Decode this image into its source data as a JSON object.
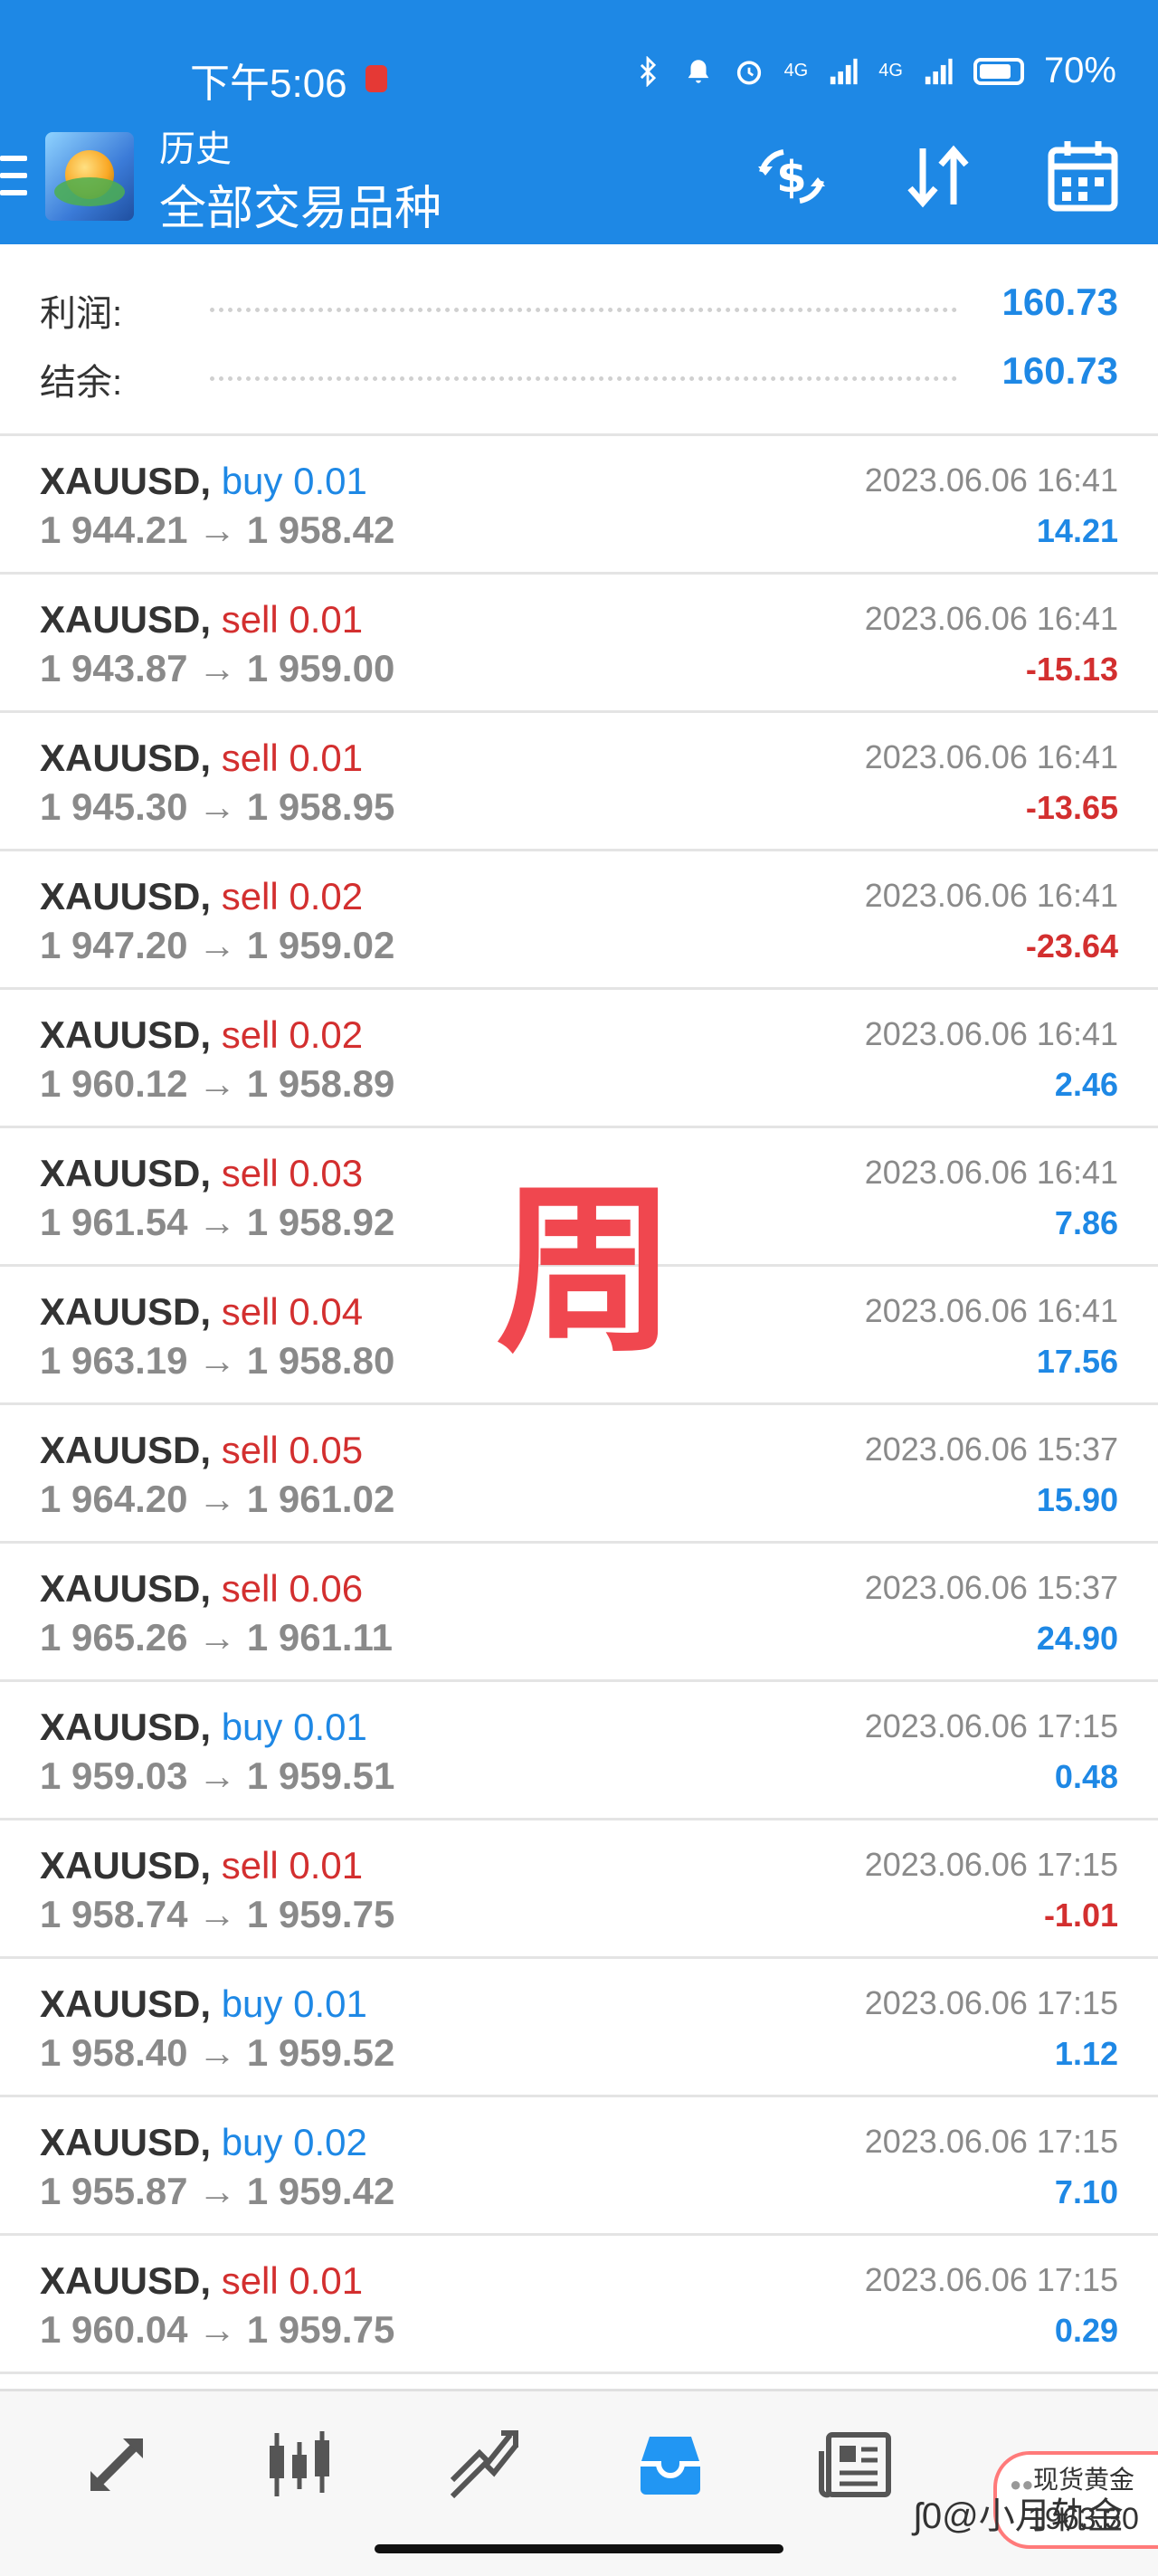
{
  "status_bar": {
    "time": "下午5:06",
    "network1": "4G",
    "network2": "4G",
    "battery": "70%"
  },
  "header": {
    "subtitle": "历史",
    "title": "全部交易品种",
    "icons": [
      "menu-icon",
      "app-logo",
      "currency-exchange-icon",
      "sort-icon",
      "calendar-icon"
    ]
  },
  "summary": {
    "profit_label": "利润:",
    "profit_value": "160.73",
    "balance_label": "结余:",
    "balance_value": "160.73"
  },
  "trades": [
    {
      "symbol": "XAUUSD,",
      "type": "buy",
      "volume": "0.01",
      "prices": "1 944.21 → 1 958.42",
      "time": "2023.06.06 16:41",
      "profit": "14.21"
    },
    {
      "symbol": "XAUUSD,",
      "type": "sell",
      "volume": "0.01",
      "prices": "1 943.87 → 1 959.00",
      "time": "2023.06.06 16:41",
      "profit": "-15.13"
    },
    {
      "symbol": "XAUUSD,",
      "type": "sell",
      "volume": "0.01",
      "prices": "1 945.30 → 1 958.95",
      "time": "2023.06.06 16:41",
      "profit": "-13.65"
    },
    {
      "symbol": "XAUUSD,",
      "type": "sell",
      "volume": "0.02",
      "prices": "1 947.20 → 1 959.02",
      "time": "2023.06.06 16:41",
      "profit": "-23.64"
    },
    {
      "symbol": "XAUUSD,",
      "type": "sell",
      "volume": "0.02",
      "prices": "1 960.12 → 1 958.89",
      "time": "2023.06.06 16:41",
      "profit": "2.46"
    },
    {
      "symbol": "XAUUSD,",
      "type": "sell",
      "volume": "0.03",
      "prices": "1 961.54 → 1 958.92",
      "time": "2023.06.06 16:41",
      "profit": "7.86"
    },
    {
      "symbol": "XAUUSD,",
      "type": "sell",
      "volume": "0.04",
      "prices": "1 963.19 → 1 958.80",
      "time": "2023.06.06 16:41",
      "profit": "17.56"
    },
    {
      "symbol": "XAUUSD,",
      "type": "sell",
      "volume": "0.05",
      "prices": "1 964.20 → 1 961.02",
      "time": "2023.06.06 15:37",
      "profit": "15.90"
    },
    {
      "symbol": "XAUUSD,",
      "type": "sell",
      "volume": "0.06",
      "prices": "1 965.26 → 1 961.11",
      "time": "2023.06.06 15:37",
      "profit": "24.90"
    },
    {
      "symbol": "XAUUSD,",
      "type": "buy",
      "volume": "0.01",
      "prices": "1 959.03 → 1 959.51",
      "time": "2023.06.06 17:15",
      "profit": "0.48"
    },
    {
      "symbol": "XAUUSD,",
      "type": "sell",
      "volume": "0.01",
      "prices": "1 958.74 → 1 959.75",
      "time": "2023.06.06 17:15",
      "profit": "-1.01"
    },
    {
      "symbol": "XAUUSD,",
      "type": "buy",
      "volume": "0.01",
      "prices": "1 958.40 → 1 959.52",
      "time": "2023.06.06 17:15",
      "profit": "1.12"
    },
    {
      "symbol": "XAUUSD,",
      "type": "buy",
      "volume": "0.02",
      "prices": "1 955.87 → 1 959.42",
      "time": "2023.06.06 17:15",
      "profit": "7.10"
    },
    {
      "symbol": "XAUUSD,",
      "type": "sell",
      "volume": "0.01",
      "prices": "1 960.04 → 1 959.75",
      "time": "2023.06.06 17:15",
      "profit": "0.29"
    }
  ],
  "watermark": "周",
  "bottom_nav": {
    "items": [
      "quotes-icon",
      "chart-icon",
      "trade-icon",
      "history-icon",
      "news-icon"
    ],
    "active": "history-icon"
  },
  "ticker": {
    "name": "现货黄金",
    "price": "1963.30"
  },
  "credit": "小月轨金",
  "colors": {
    "accent": "#1e88e5",
    "buy": "#1e88e5",
    "sell": "#d32f2f",
    "watermark": "#f0474f"
  }
}
